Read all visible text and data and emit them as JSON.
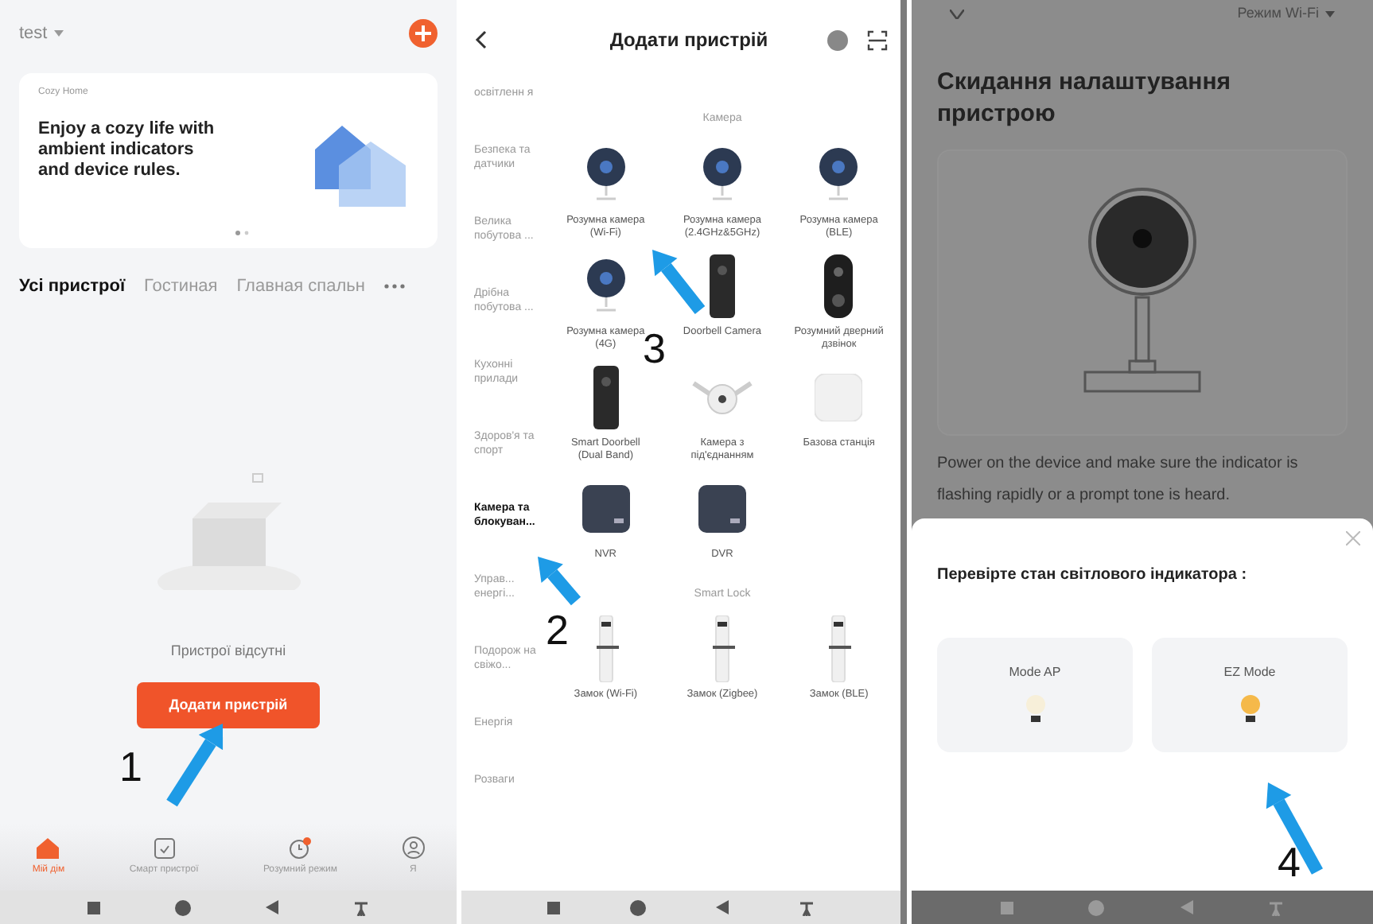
{
  "home_screen": {
    "home_name": "test",
    "banner": {
      "label": "Cozy Home",
      "text": "Enjoy a cozy life with ambient indicators and device rules."
    },
    "room_tabs": [
      {
        "label": "Усі пристрої",
        "selected": true
      },
      {
        "label": "Гостиная",
        "selected": false
      },
      {
        "label": "Главная спальн",
        "selected": false
      }
    ],
    "empty_text": "Пристрої відсутні",
    "add_button": "Додати пристрій",
    "bottom_nav": [
      {
        "label": "Мій дім",
        "kind": "home",
        "selected": true
      },
      {
        "label": "Смарт пристрої",
        "kind": "devices",
        "selected": false
      },
      {
        "label": "Розумний режим",
        "kind": "scene",
        "selected": false
      },
      {
        "label": "Я",
        "kind": "profile",
        "selected": false
      }
    ]
  },
  "add_device": {
    "title": "Додати пристрій",
    "categories": [
      {
        "label": "освітленн я",
        "selected": false
      },
      {
        "label": "Безпека та датчики",
        "selected": false
      },
      {
        "label": "Велика побутова ...",
        "selected": false
      },
      {
        "label": "Дрібна побутова ...",
        "selected": false
      },
      {
        "label": "Кухонні прилади",
        "selected": false
      },
      {
        "label": "Здоров'я та спорт",
        "selected": false
      },
      {
        "label": "Камера та блокуван...",
        "selected": true
      },
      {
        "label": "Управ... енергі...",
        "selected": false
      },
      {
        "label": "Подорож на свіжо...",
        "selected": false
      },
      {
        "label": "Енергія",
        "selected": false
      },
      {
        "label": "Розваги",
        "selected": false
      }
    ],
    "sections": [
      {
        "title": "Камера",
        "devices": [
          {
            "name": "Розумна камера (Wi-Fi)",
            "kind": "camera"
          },
          {
            "name": "Розумна камера (2.4GHz&5GHz)",
            "kind": "camera"
          },
          {
            "name": "Розумна камера (BLE)",
            "kind": "camera"
          },
          {
            "name": "Розумна камера (4G)",
            "kind": "camera"
          },
          {
            "name": "Doorbell Camera",
            "kind": "doorbell"
          },
          {
            "name": "Розумний дверний дзвінок",
            "kind": "doorbell_round"
          },
          {
            "name": "Smart Doorbell (Dual Band)",
            "kind": "doorbell"
          },
          {
            "name": "Камера з під'єднанням",
            "kind": "solar_camera"
          },
          {
            "name": "Базова станція",
            "kind": "base_station"
          },
          {
            "name": "NVR",
            "kind": "recorder"
          },
          {
            "name": "DVR",
            "kind": "recorder"
          }
        ]
      },
      {
        "title": "Smart Lock",
        "devices": [
          {
            "name": "Замок (Wi-Fi)",
            "kind": "lock"
          },
          {
            "name": "Замок (Zigbee)",
            "kind": "lock"
          },
          {
            "name": "Замок (BLE)",
            "kind": "lock"
          }
        ]
      }
    ]
  },
  "reset_screen": {
    "mode": "Режим Wi-Fi",
    "title": "Скидання налаштування пристрою",
    "instructions": "Power on the device and make sure the indicator is flashing rapidly or a prompt tone is heard.",
    "sheet": {
      "title": "Перевірте стан світлового індикатора :",
      "modes": [
        {
          "label": "Mode AP",
          "lit": false
        },
        {
          "label": "EZ Mode",
          "lit": true
        }
      ]
    }
  },
  "annotations": [
    {
      "label": "1"
    },
    {
      "label": "2"
    },
    {
      "label": "3"
    },
    {
      "label": "4"
    }
  ]
}
